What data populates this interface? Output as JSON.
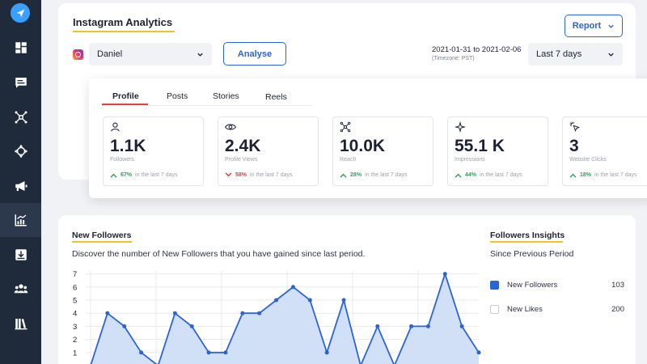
{
  "sidebar": {
    "items": [
      {
        "icon": "dashboard-icon",
        "active": false
      },
      {
        "icon": "message-icon",
        "active": false
      },
      {
        "icon": "network-icon",
        "active": false
      },
      {
        "icon": "move-icon",
        "active": false
      },
      {
        "icon": "megaphone-icon",
        "active": false
      },
      {
        "icon": "analytics-icon",
        "active": true
      },
      {
        "icon": "download-icon",
        "active": false
      },
      {
        "icon": "users-icon",
        "active": false
      },
      {
        "icon": "library-icon",
        "active": false
      }
    ]
  },
  "header": {
    "title": "Instagram Analytics",
    "report_label": "Report",
    "account": "Daniel",
    "analyse_label": "Analyse",
    "date_range": "2021-01-31 to 2021-02-06",
    "timezone": "(Timezone: PST)",
    "range_option": "Last 7 days"
  },
  "tabs": [
    {
      "label": "Profile",
      "active": true
    },
    {
      "label": "Posts",
      "active": false
    },
    {
      "label": "Stories",
      "active": false
    },
    {
      "label": "Reels",
      "active": false
    }
  ],
  "stats": [
    {
      "icon": "user-icon",
      "value": "1.1K",
      "label": "Followers",
      "change": "67%",
      "trend": "up",
      "suffix": "in the last 7 days"
    },
    {
      "icon": "eye-icon",
      "value": "2.4K",
      "label": "Profile Views",
      "change": "58%",
      "trend": "down",
      "suffix": "in the last 7 days"
    },
    {
      "icon": "share-nodes-icon",
      "value": "10.0K",
      "label": "Reach",
      "change": "28%",
      "trend": "up",
      "suffix": "in the last 7 days"
    },
    {
      "icon": "sparkle-icon",
      "value": "55.1 K",
      "label": "Impressions",
      "change": "44%",
      "trend": "up",
      "suffix": "in the last 7 days"
    },
    {
      "icon": "cursor-click-icon",
      "value": "3",
      "label": "Website Clicks",
      "change": "18%",
      "trend": "up",
      "suffix": "in the last 7 days"
    }
  ],
  "followers": {
    "title": "New Followers",
    "description": "Discover the number of New Followers that you have gained since last period."
  },
  "insights": {
    "title": "Followers Insights",
    "subtitle": "Since Previous Period",
    "rows": [
      {
        "label": "New Followers",
        "value": "103",
        "checked": true
      },
      {
        "label": "New Likes",
        "value": "200",
        "checked": false
      }
    ]
  },
  "colors": {
    "accent": "#2a64d6",
    "underline": "#f2c22a",
    "up": "#27a35a",
    "down": "#d8403a",
    "sidebar": "#1f2a3a"
  },
  "chart_data": {
    "type": "area",
    "title": "",
    "xlabel": "",
    "ylabel": "",
    "ylim": [
      0,
      7
    ],
    "yticks": [
      1,
      2,
      3,
      4,
      5,
      6,
      7
    ],
    "series": [
      {
        "values": [
          0,
          4,
          3,
          1,
          0,
          4,
          3,
          1,
          1,
          4,
          4,
          5,
          6,
          5,
          1,
          5,
          0,
          3,
          0,
          3,
          3,
          7,
          3,
          1
        ]
      }
    ],
    "grid": true
  }
}
